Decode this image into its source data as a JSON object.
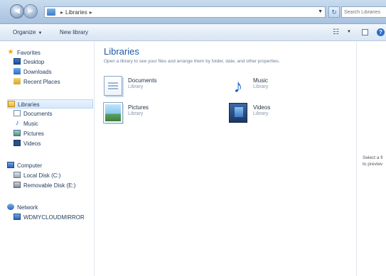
{
  "address_bar": {
    "crumbs": [
      "Libraries"
    ],
    "search_placeholder": "Search Libraries"
  },
  "command_bar": {
    "organize_label": "Organize",
    "new_library_label": "New library"
  },
  "nav": {
    "favorites": {
      "label": "Favorites",
      "items": [
        "Desktop",
        "Downloads",
        "Recent Places"
      ]
    },
    "libraries": {
      "label": "Libraries",
      "items": [
        "Documents",
        "Music",
        "Pictures",
        "Videos"
      ]
    },
    "computer": {
      "label": "Computer",
      "items": [
        "Local Disk (C:)",
        "Removable Disk (E:)"
      ]
    },
    "network": {
      "label": "Network",
      "items": [
        "WDMYCLOUDMIRROR"
      ]
    }
  },
  "content": {
    "title": "Libraries",
    "description": "Open a library to see your files and arrange them by folder, date, and other properties.",
    "libraries": [
      {
        "name": "Documents",
        "type": "Library"
      },
      {
        "name": "Music",
        "type": "Library"
      },
      {
        "name": "Pictures",
        "type": "Library"
      },
      {
        "name": "Videos",
        "type": "Library"
      }
    ]
  },
  "preview": {
    "line1": "Select a fi",
    "line2": "to previev"
  },
  "colors": {
    "title_blue": "#1e5aa8",
    "selection_bg": "#d6e8fb",
    "chrome_blue": "#b4cbe4"
  }
}
